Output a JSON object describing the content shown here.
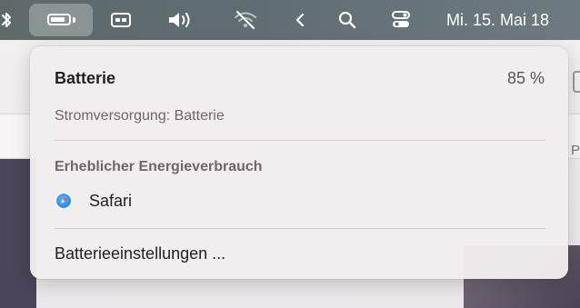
{
  "menubar": {
    "bluetooth_icon": "bluetooth-icon",
    "battery_icon": "battery-icon",
    "display_icon": "display-icon",
    "volume_icon": "volume-icon",
    "wifi_icon": "wifi-off-icon",
    "chevron_icon": "chevron-left-icon",
    "search_icon": "search-icon",
    "control_center_icon": "control-center-icon",
    "clock": "Mi. 15. Mai 18"
  },
  "battery_menu": {
    "title": "Batterie",
    "percent": "85 %",
    "level": 0.85,
    "power_source": "Stromversorgung: Batterie",
    "section_title": "Erheblicher Energieverbrauch",
    "apps": [
      {
        "name": "Safari",
        "icon": "safari-icon"
      }
    ],
    "settings_label": "Batterieeinstellungen ..."
  },
  "colors": {
    "menubar": "#5f6d73",
    "popover": "#f2ecee",
    "safari_blue": "#1e7cf2"
  }
}
